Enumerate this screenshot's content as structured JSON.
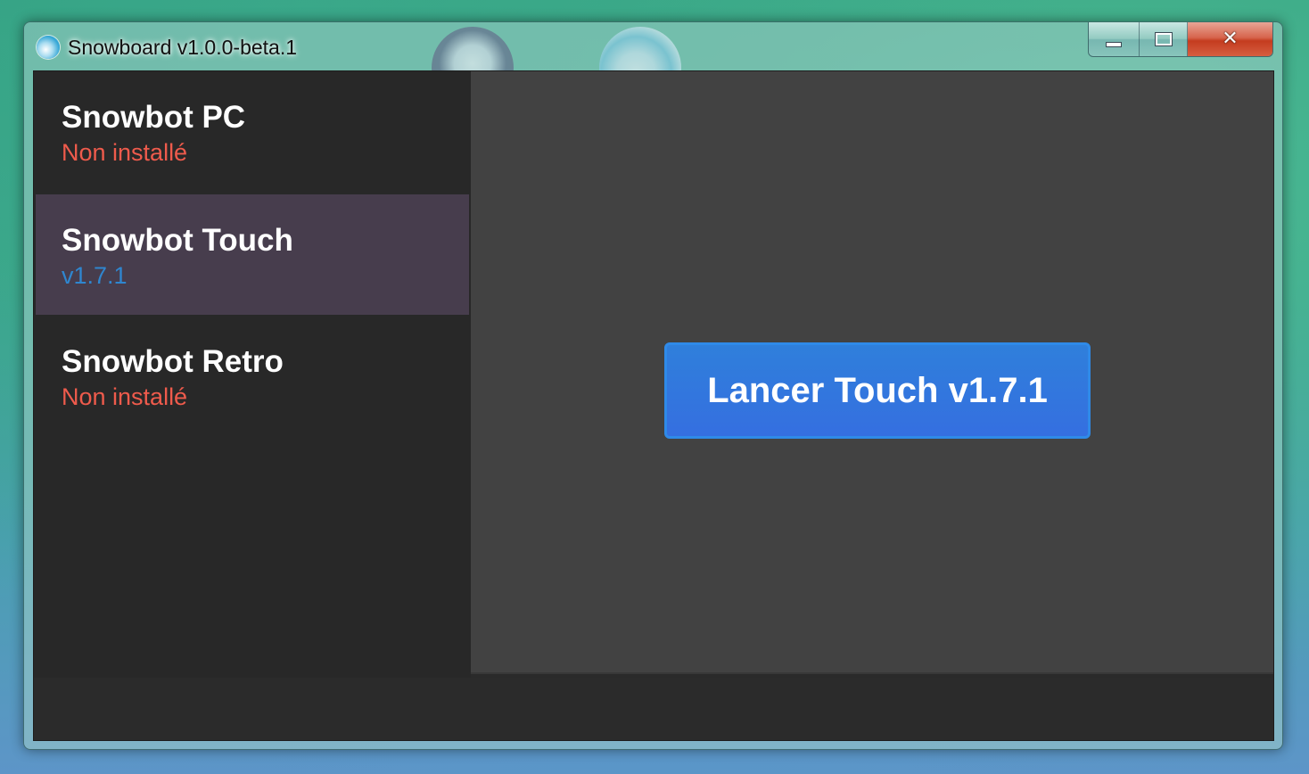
{
  "window": {
    "title": "Snowboard v1.0.0-beta.1",
    "controls": {
      "minimize_icon": "minimize-icon",
      "maximize_icon": "maximize-icon",
      "close_glyph": "✕"
    }
  },
  "sidebar": {
    "items": [
      {
        "name": "Snowbot PC",
        "status": "Non installé",
        "status_kind": "not-installed",
        "selected": false
      },
      {
        "name": "Snowbot Touch",
        "status": "v1.7.1",
        "status_kind": "version",
        "selected": true
      },
      {
        "name": "Snowbot Retro",
        "status": "Non installé",
        "status_kind": "not-installed",
        "selected": false
      }
    ]
  },
  "main": {
    "launch_label": "Lancer Touch v1.7.1"
  },
  "colors": {
    "not_installed": "#ef5b4c",
    "version": "#2f86cf",
    "selected_bg": "#473d4d",
    "button_bg": "#356fe0",
    "button_border": "#2f8ae8",
    "sidebar_bg": "#282828",
    "main_bg": "#424242"
  }
}
